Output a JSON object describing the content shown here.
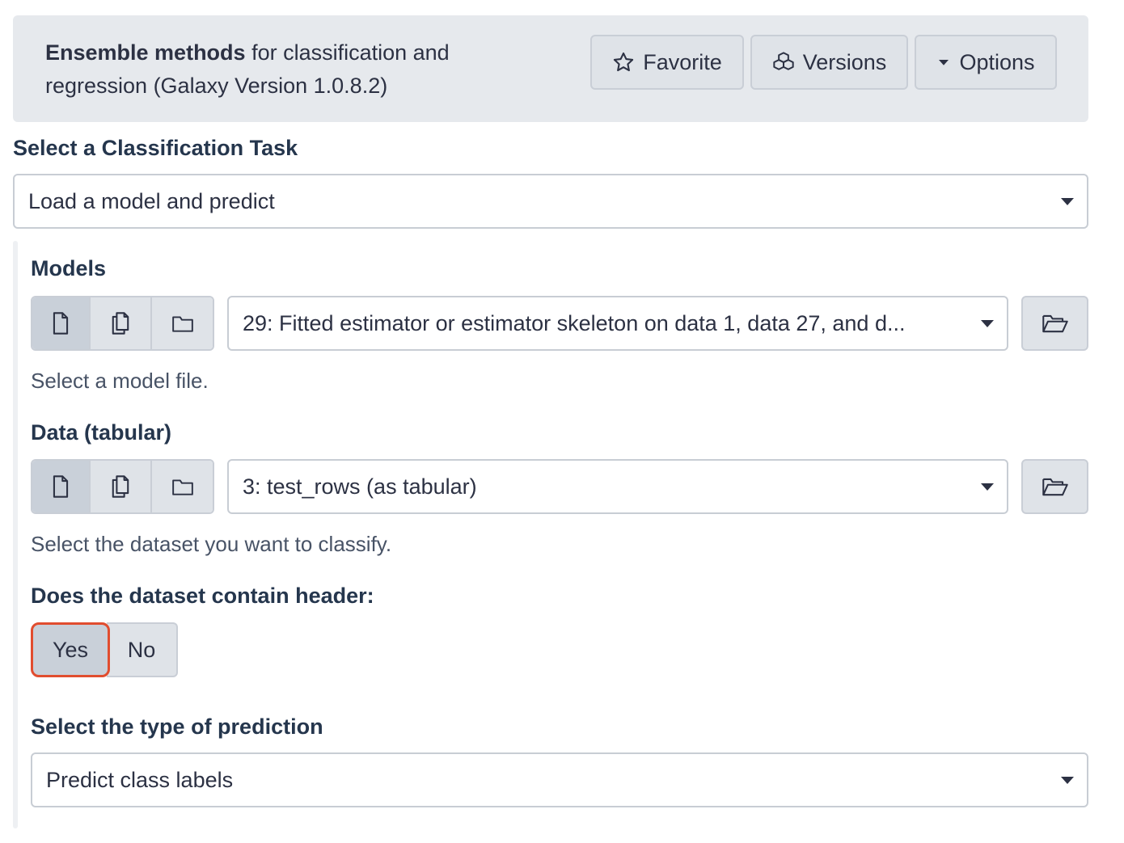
{
  "header": {
    "title_bold": "Ensemble methods",
    "title_rest": " for classification and regression (Galaxy Version 1.0.8.2)",
    "favorite_label": "Favorite",
    "versions_label": "Versions",
    "options_label": "Options"
  },
  "classification_task": {
    "label": "Select a Classification Task",
    "value": "Load a model and predict"
  },
  "models": {
    "label": "Models",
    "value": "29: Fitted estimator or estimator skeleton on data 1, data 27, and d...",
    "help": "Select a model file."
  },
  "data": {
    "label": "Data (tabular)",
    "value": "3: test_rows (as tabular)",
    "help": "Select the dataset you want to classify."
  },
  "header_option": {
    "label": "Does the dataset contain header:",
    "yes": "Yes",
    "no": "No",
    "selected": "Yes"
  },
  "prediction_type": {
    "label": "Select the type of prediction",
    "value": "Predict class labels"
  },
  "colors": {
    "highlight": "#e14d2f",
    "button_bg": "#dfe3e8",
    "active_bg": "#c9d0d9"
  },
  "icons": [
    "star-icon",
    "cubes-icon",
    "caret-down-icon",
    "file-icon",
    "files-icon",
    "folder-icon",
    "folder-open-icon"
  ]
}
